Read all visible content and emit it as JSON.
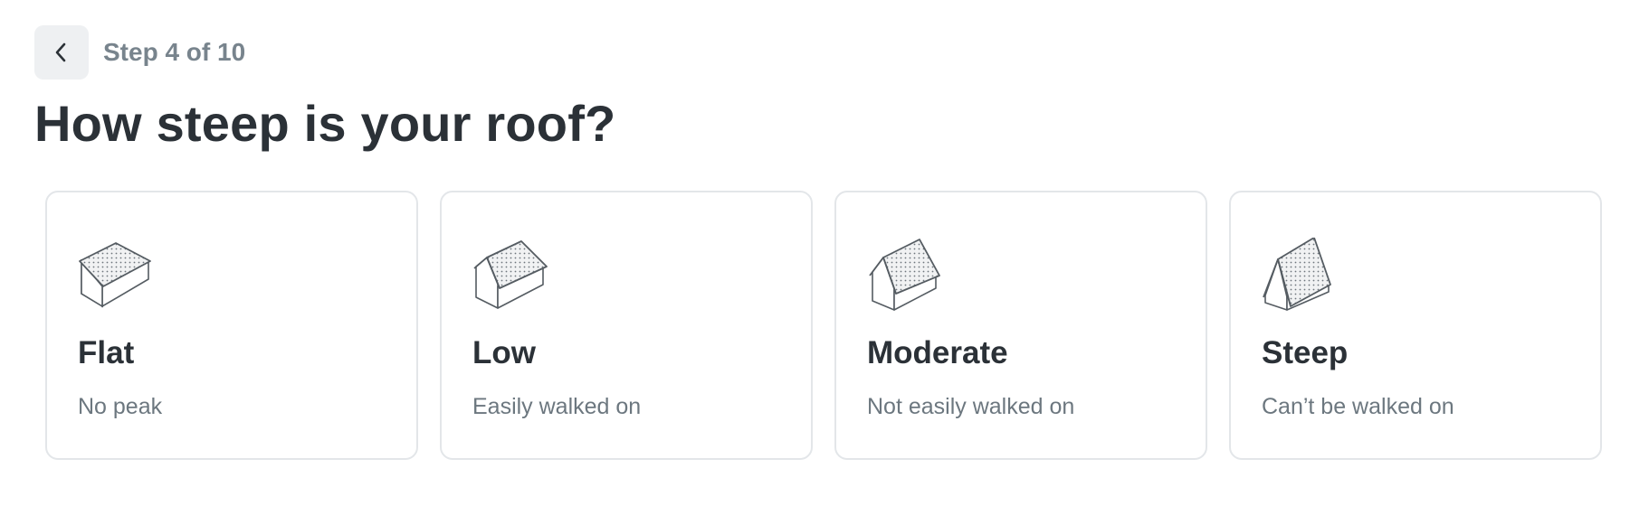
{
  "header": {
    "back_icon": "chevron-left-icon",
    "step_label": "Step 4 of 10"
  },
  "question": {
    "title": "How steep is your roof?"
  },
  "options": [
    {
      "icon": "flat-roof-icon",
      "title": "Flat",
      "subtitle": "No peak"
    },
    {
      "icon": "low-roof-icon",
      "title": "Low",
      "subtitle": "Easily walked on"
    },
    {
      "icon": "moderate-roof-icon",
      "title": "Moderate",
      "subtitle": "Not easily walked on"
    },
    {
      "icon": "steep-roof-icon",
      "title": "Steep",
      "subtitle": "Can’t be walked on"
    }
  ],
  "colors": {
    "text_primary": "#2b3137",
    "text_muted": "#78848d",
    "card_border": "#e3e6e9",
    "back_button_bg": "#eef0f2"
  }
}
